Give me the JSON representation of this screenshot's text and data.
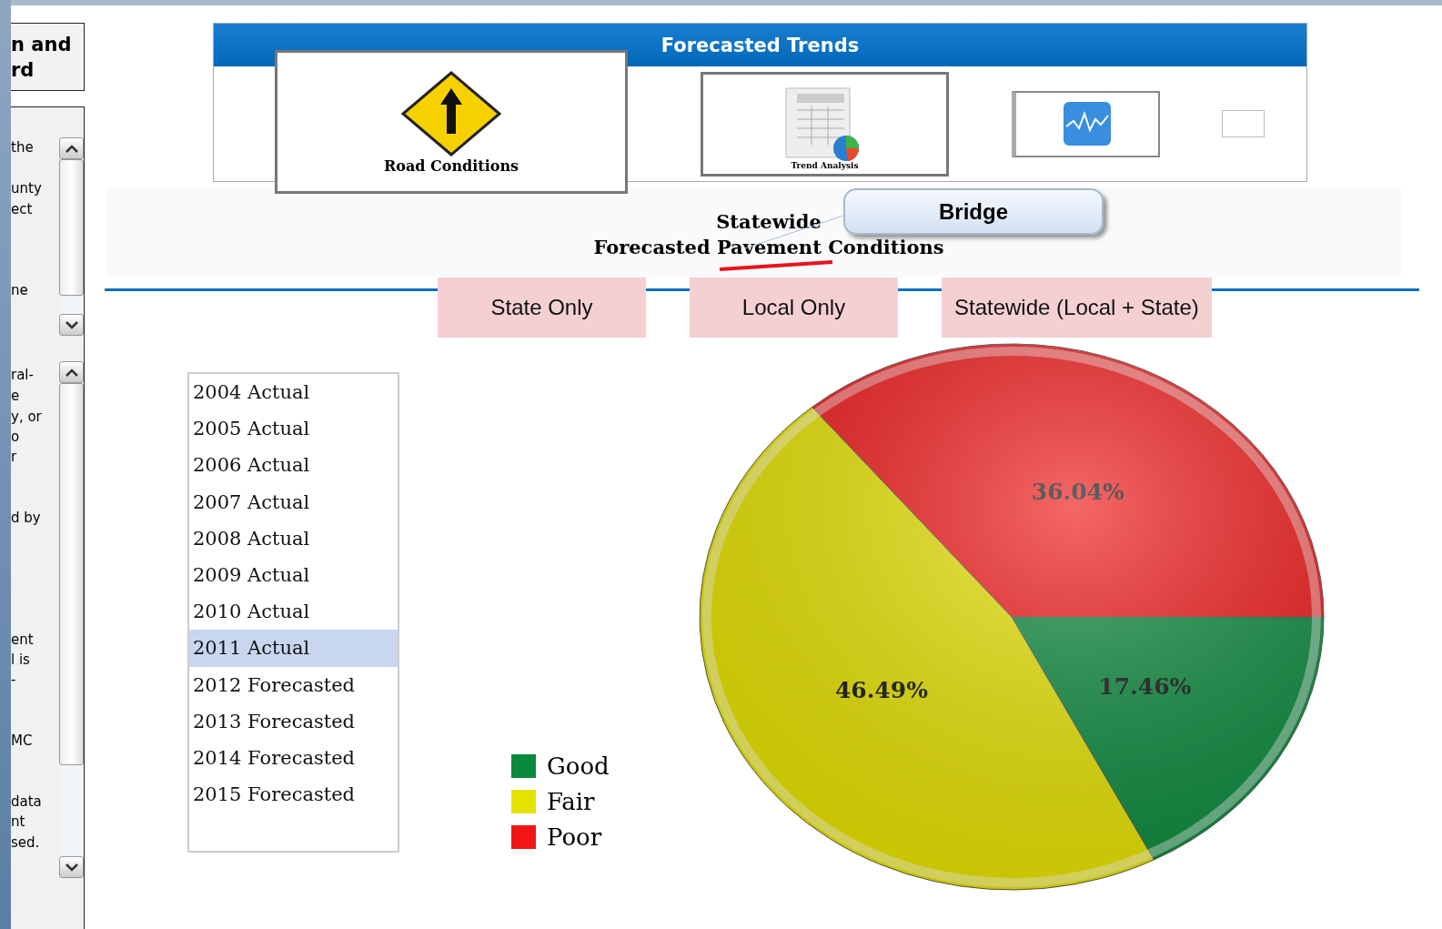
{
  "side_panel": {
    "heading": [
      "n and",
      "rd"
    ],
    "fragments": [
      "the",
      "unty",
      "ect",
      "ne",
      "ral-",
      "e",
      "y, or",
      "o",
      "r",
      "d by",
      "ent",
      "l is",
      "-",
      "MC",
      "data",
      "nt",
      "sed."
    ]
  },
  "banner": {
    "title": "Forecasted Trends",
    "cards": [
      {
        "kind": "road",
        "label": "Road Conditions"
      },
      {
        "kind": "trend",
        "label": "Trend Analysis"
      },
      {
        "kind": "monitor"
      },
      {
        "kind": "blank"
      }
    ]
  },
  "heading": {
    "lines": [
      "Statewide",
      "Forecasted Pavement Conditions"
    ],
    "callout": "Bridge"
  },
  "tabs": [
    {
      "label": "State Only"
    },
    {
      "label": "Local Only"
    },
    {
      "label": "Statewide (Local + State)"
    }
  ],
  "years": [
    {
      "label": "2004 Actual",
      "selected": false
    },
    {
      "label": "2005 Actual",
      "selected": false
    },
    {
      "label": "2006 Actual",
      "selected": false
    },
    {
      "label": "2007 Actual",
      "selected": false
    },
    {
      "label": "2008 Actual",
      "selected": false
    },
    {
      "label": "2009 Actual",
      "selected": false
    },
    {
      "label": "2010 Actual",
      "selected": false
    },
    {
      "label": "2011 Actual",
      "selected": true
    },
    {
      "label": "2012 Forecasted",
      "selected": false
    },
    {
      "label": "2013 Forecasted",
      "selected": false
    },
    {
      "label": "2014 Forecasted",
      "selected": false
    },
    {
      "label": "2015 Forecasted",
      "selected": false
    }
  ],
  "chart_data": {
    "type": "pie",
    "categories": [
      "Good",
      "Fair",
      "Poor"
    ],
    "values": [
      17.46,
      46.49,
      36.04
    ],
    "colors": [
      "#0a8a3c",
      "#e6e200",
      "#f01616"
    ],
    "legend": "left",
    "value_labels": [
      "17.46%",
      "46.49%",
      "36.04%"
    ]
  }
}
